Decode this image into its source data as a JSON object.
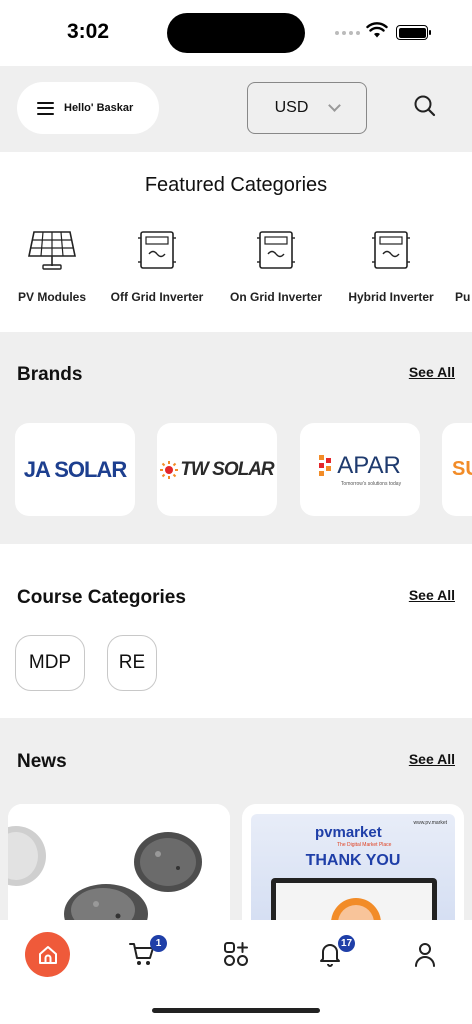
{
  "status_bar": {
    "time": "3:02"
  },
  "header": {
    "greeting": "Hello' Baskar",
    "currency": "USD"
  },
  "featured": {
    "title": "Featured Categories",
    "items": [
      {
        "label": "PV Modules",
        "icon": "solar-panel-icon"
      },
      {
        "label": "Off Grid Inverter",
        "icon": "inverter-icon"
      },
      {
        "label": "On Grid Inverter",
        "icon": "inverter-icon"
      },
      {
        "label": "Hybrid Inverter",
        "icon": "inverter-icon"
      },
      {
        "label": "Pu",
        "icon": "pump-icon"
      }
    ]
  },
  "brands": {
    "title": "Brands",
    "see_all": "See All",
    "items": [
      {
        "name": "JA SOLAR",
        "color": "#1d3f8f"
      },
      {
        "name": "TW SOLAR",
        "color": "#2a2a2a",
        "accent": "#e4262a"
      },
      {
        "name": "APAR",
        "tagline": "Tomorrow's solutions today",
        "color": "#1e3a6e",
        "accent": "#f28c28"
      },
      {
        "name": "SU",
        "color": "#f28c28"
      }
    ]
  },
  "courses": {
    "title": "Course Categories",
    "see_all": "See All",
    "items": [
      {
        "label": "MDP"
      },
      {
        "label": "RE"
      }
    ]
  },
  "news": {
    "title": "News",
    "see_all": "See All",
    "cards": [
      {
        "image": "mineral-granules"
      },
      {
        "brand": "pvmarket",
        "tagline": "The Digital Market Place",
        "url": "www.pv.market",
        "headline": "THANK YOU"
      }
    ]
  },
  "bottom_nav": {
    "cart_badge": "1",
    "notification_badge": "17",
    "colors": {
      "home_active": "#ef5a3a",
      "badge": "#1f3fa8"
    }
  }
}
